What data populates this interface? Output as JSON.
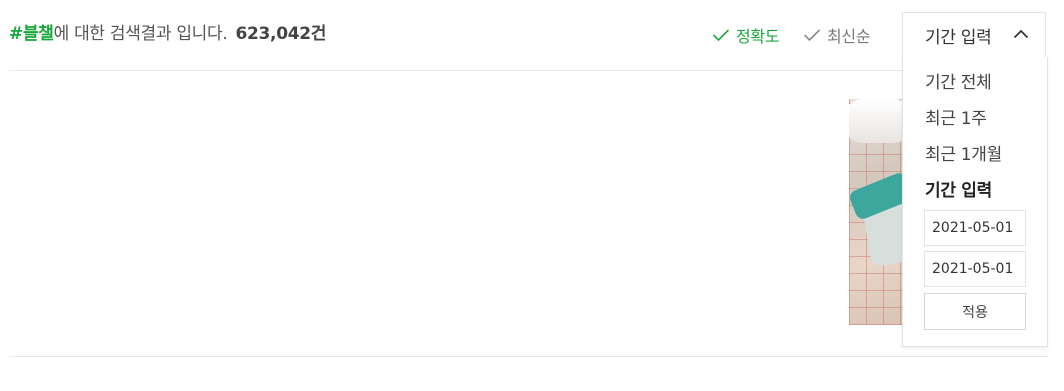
{
  "search_summary": {
    "hashtag": "#블챌",
    "suffix": "에 대한 검색결과 입니다.",
    "count": "623,042건"
  },
  "sort": {
    "accuracy_label": "정확도",
    "latest_label": "최신순",
    "active": "accuracy"
  },
  "period_filter": {
    "button_label": "기간 입력",
    "expanded": true,
    "options": [
      "기간 전체",
      "최근 1주",
      "최근 1개월",
      "기간 입력"
    ],
    "selected": "기간 입력",
    "start_date": "2021-05-01",
    "end_date": "2021-05-01",
    "apply_label": "적용"
  },
  "colors": {
    "accent_green": "#18a83a",
    "border": "#e3e3e3"
  },
  "icons": {
    "sort_check": "check-icon",
    "dropdown": "chevron-up-icon"
  }
}
